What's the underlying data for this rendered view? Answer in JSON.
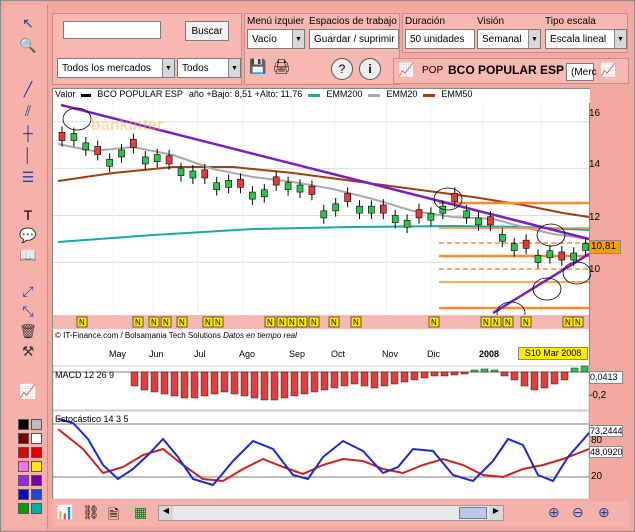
{
  "search": {
    "placeholder": "",
    "value": "",
    "button": "Buscar",
    "market": "Todos los mercados",
    "filter": "Todos"
  },
  "menu": {
    "label": "Menú izquier",
    "value": "Vacío"
  },
  "workspace": {
    "label": "Espacios de trabajo",
    "value": "Guardar / suprimir"
  },
  "duration": {
    "label": "Duración",
    "value": "50 unidades"
  },
  "view": {
    "label": "Visión",
    "value": "Semanal"
  },
  "scale": {
    "label": "Tipo escala",
    "value": "Escala lineal"
  },
  "ticker": {
    "code": "POP",
    "name": "BCO POPULAR ESP",
    "market": "(Merc"
  },
  "chart": {
    "legend_value": "Valor",
    "legend_name": "BCO POPULAR ESP",
    "legend_range": "año +Bajo: 8,51 +Alto: 11,76",
    "emm200": "EMM200",
    "emm20": "EMM20",
    "emm50": "EMM50",
    "watermark": "bankinter.",
    "credit": "© IT-Finance.com / Bolsamania Tech Solutions",
    "credit_rt": "Datos en tiempo real",
    "last_price": "10,81",
    "date_box": "S10 Mar 2008",
    "months": [
      "May",
      "Jun",
      "Jul",
      "Ago",
      "Sep",
      "Oct",
      "Nov",
      "Dic",
      "2008",
      "Feb"
    ],
    "yticks": [
      "16",
      "14",
      "12",
      "10"
    ]
  },
  "macd": {
    "label": "MACD 12 26 9",
    "value": "0,0413",
    "tick": "-0,2"
  },
  "stoch": {
    "label": "Estocástico 14 3 5",
    "v1": "73,2444",
    "v2": "48,0920",
    "tick80": "80",
    "tick20": "20"
  },
  "colors": {
    "emm200": "#1aa9a0",
    "emm20": "#a8a8a8",
    "emm50": "#a0400f",
    "trend": "#7a1ec0",
    "bg": "#f3a9a0"
  },
  "chart_data": {
    "type": "candlestick",
    "x": [
      "2007-04",
      "2007-05",
      "2007-06",
      "2007-07",
      "2007-08",
      "2007-09",
      "2007-10",
      "2007-11",
      "2007-12",
      "2008-01",
      "2008-02",
      "2008-03"
    ],
    "close": [
      15.6,
      15.0,
      14.6,
      14.1,
      13.3,
      12.2,
      12.1,
      11.5,
      12.3,
      10.5,
      10.0,
      10.81
    ],
    "ylim": [
      7.8,
      16.8
    ]
  }
}
